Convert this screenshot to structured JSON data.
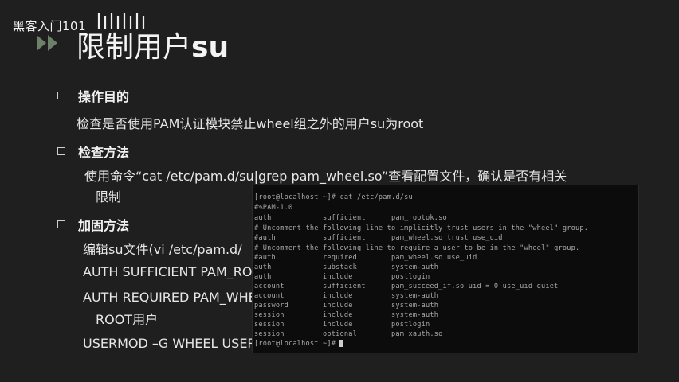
{
  "watermark": {
    "text": "黑客入门101"
  },
  "title": {
    "prefix": "限制用户",
    "bold": "su"
  },
  "sections": {
    "purpose": {
      "title": "操作目的",
      "text": "检查是否使用PAM认证模块禁止wheel组之外的用户su为root"
    },
    "check": {
      "title": "检查方法",
      "line1": "使用命令“cat /etc/pam.d/su|grep pam_wheel.so”查看配置文件，确认是否有相关",
      "line2": "限制"
    },
    "harden": {
      "title": "加固方法",
      "line1": "编辑su文件(vi /etc/pam.d/",
      "line2": "AUTH SUFFICIENT PAM_ROOTO",
      "line3": "AUTH REQUIRED PAM_WHEEL",
      "line4": "ROOT用户",
      "line5": "USERMOD –G WHEEL USERNA"
    }
  },
  "terminal": {
    "lines": [
      "[root@localhost ~]# cat /etc/pam.d/su",
      "#%PAM-1.0",
      "auth            sufficient      pam_rootok.so",
      "# Uncomment the following line to implicitly trust users in the \"wheel\" group.",
      "#auth           sufficient      pam_wheel.so trust use_uid",
      "# Uncomment the following line to require a user to be in the \"wheel\" group.",
      "#auth           required        pam_wheel.so use_uid",
      "auth            substack        system-auth",
      "auth            include         postlogin",
      "account         sufficient      pam_succeed_if.so uid = 0 use_uid quiet",
      "account         include         system-auth",
      "password        include         system-auth",
      "session         include         system-auth",
      "session         include         postlogin",
      "session         optional        pam_xauth.so",
      "[root@localhost ~]# "
    ]
  }
}
